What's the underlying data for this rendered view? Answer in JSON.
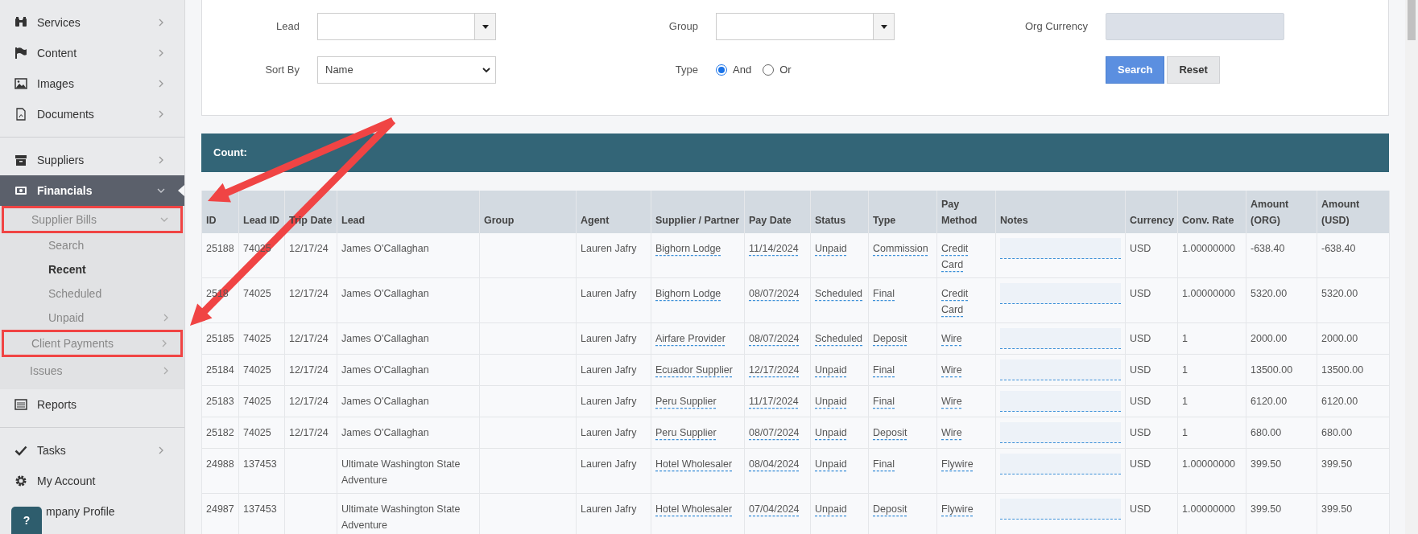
{
  "sidebar": {
    "sections": [
      {
        "items": [
          {
            "label": "Services",
            "selected": false,
            "expanded": false
          },
          {
            "label": "Content",
            "selected": false,
            "expanded": false
          },
          {
            "label": "Images",
            "selected": false,
            "expanded": false
          },
          {
            "label": "Documents",
            "selected": false,
            "expanded": false
          }
        ]
      },
      {
        "items": [
          {
            "label": "Suppliers",
            "selected": false,
            "expanded": false
          },
          {
            "label": "Financials",
            "selected": true,
            "expanded": true,
            "children": [
              {
                "label": "Supplier Bills",
                "highlighted": true,
                "expanded": true,
                "children": [
                  {
                    "label": "Search",
                    "selected": false
                  },
                  {
                    "label": "Recent",
                    "selected": true
                  },
                  {
                    "label": "Scheduled",
                    "selected": false
                  },
                  {
                    "label": "Unpaid",
                    "selected": false,
                    "expanded": false
                  }
                ]
              },
              {
                "label": "Client Payments",
                "highlighted": true,
                "expanded": false
              },
              {
                "label": "Issues",
                "highlighted": false,
                "expanded": false
              }
            ]
          },
          {
            "label": "Reports",
            "selected": false
          }
        ]
      },
      {
        "items": [
          {
            "label": "Tasks",
            "selected": false,
            "expanded": false
          },
          {
            "label": "My Account",
            "selected": false
          },
          {
            "label": "mpany Profile",
            "selected": false
          }
        ]
      }
    ]
  },
  "help_button": "?",
  "filters": {
    "lead": {
      "label": "Lead"
    },
    "group": {
      "label": "Group"
    },
    "org_currency": {
      "label": "Org Currency"
    },
    "sort_by": {
      "label": "Sort By",
      "value": "Name"
    },
    "type": {
      "label": "Type",
      "options": [
        {
          "label": "And",
          "selected": true
        },
        {
          "label": "Or",
          "selected": false
        }
      ]
    },
    "buttons": [
      "Search",
      "Reset"
    ]
  },
  "summary": {
    "count_label": "Count:"
  },
  "table": {
    "columns": [
      {
        "label": "ID",
        "kind": "text"
      },
      {
        "label": "Lead ID",
        "kind": "text"
      },
      {
        "label": "Trip Date",
        "kind": "text"
      },
      {
        "label": "Lead",
        "kind": "text"
      },
      {
        "label": "Group",
        "kind": "text"
      },
      {
        "label": "Agent",
        "kind": "text"
      },
      {
        "label": "Supplier / Partner",
        "kind": "link"
      },
      {
        "label": "Pay Date",
        "kind": "link"
      },
      {
        "label": "Status",
        "kind": "link"
      },
      {
        "label": "Type",
        "kind": "link"
      },
      {
        "label": "Pay Method",
        "kind": "link"
      },
      {
        "label": "Notes",
        "kind": "field"
      },
      {
        "label": "Currency",
        "kind": "text"
      },
      {
        "label": "Conv. Rate",
        "kind": "text"
      },
      {
        "label": "Amount (ORG)",
        "kind": "text"
      },
      {
        "label": "Amount (USD)",
        "kind": "text"
      }
    ],
    "rows": [
      {
        "cells": [
          "25188",
          "74025",
          "12/17/24",
          "James O'Callaghan",
          null,
          "Lauren Jafry",
          "Bighorn Lodge",
          "11/14/2024",
          "Unpaid",
          "Commission",
          "Credit Card",
          null,
          "USD",
          "1.00000000",
          "-638.40",
          "-638.40"
        ]
      },
      {
        "cells": [
          "2518",
          "74025",
          "12/17/24",
          "James O'Callaghan",
          null,
          "Lauren Jafry",
          "Bighorn Lodge",
          "08/07/2024",
          "Scheduled",
          "Final",
          "Credit Card",
          null,
          "USD",
          "1.00000000",
          "5320.00",
          "5320.00"
        ]
      },
      {
        "cells": [
          "25185",
          "74025",
          "12/17/24",
          "James O'Callaghan",
          null,
          "Lauren Jafry",
          "Airfare Provider",
          "08/07/2024",
          "Scheduled",
          "Deposit",
          "Wire",
          null,
          "USD",
          "1",
          "2000.00",
          "2000.00"
        ]
      },
      {
        "cells": [
          "25184",
          "74025",
          "12/17/24",
          "James O'Callaghan",
          null,
          "Lauren Jafry",
          "Ecuador Supplier",
          "12/17/2024",
          "Unpaid",
          "Final",
          "Wire",
          null,
          "USD",
          "1",
          "13500.00",
          "13500.00"
        ]
      },
      {
        "cells": [
          "25183",
          "74025",
          "12/17/24",
          "James O'Callaghan",
          null,
          "Lauren Jafry",
          "Peru Supplier",
          "11/17/2024",
          "Unpaid",
          "Final",
          "Wire",
          null,
          "USD",
          "1",
          "6120.00",
          "6120.00"
        ]
      },
      {
        "cells": [
          "25182",
          "74025",
          "12/17/24",
          "James O'Callaghan",
          null,
          "Lauren Jafry",
          "Peru Supplier",
          "08/07/2024",
          "Unpaid",
          "Deposit",
          "Wire",
          null,
          "USD",
          "1",
          "680.00",
          "680.00"
        ]
      },
      {
        "cells": [
          "24988",
          "137453",
          null,
          "Ultimate Washington State Adventure",
          null,
          "Lauren Jafry",
          "Hotel Wholesaler",
          "08/04/2024",
          "Unpaid",
          "Final",
          "Flywire",
          null,
          "USD",
          "1.00000000",
          "399.50",
          "399.50"
        ]
      },
      {
        "cells": [
          "24987",
          "137453",
          null,
          "Ultimate Washington State Adventure",
          null,
          "Lauren Jafry",
          "Hotel Wholesaler",
          "07/04/2024",
          "Unpaid",
          "Deposit",
          "Flywire",
          null,
          "USD",
          "1.00000000",
          "399.50",
          "399.50"
        ]
      }
    ]
  }
}
